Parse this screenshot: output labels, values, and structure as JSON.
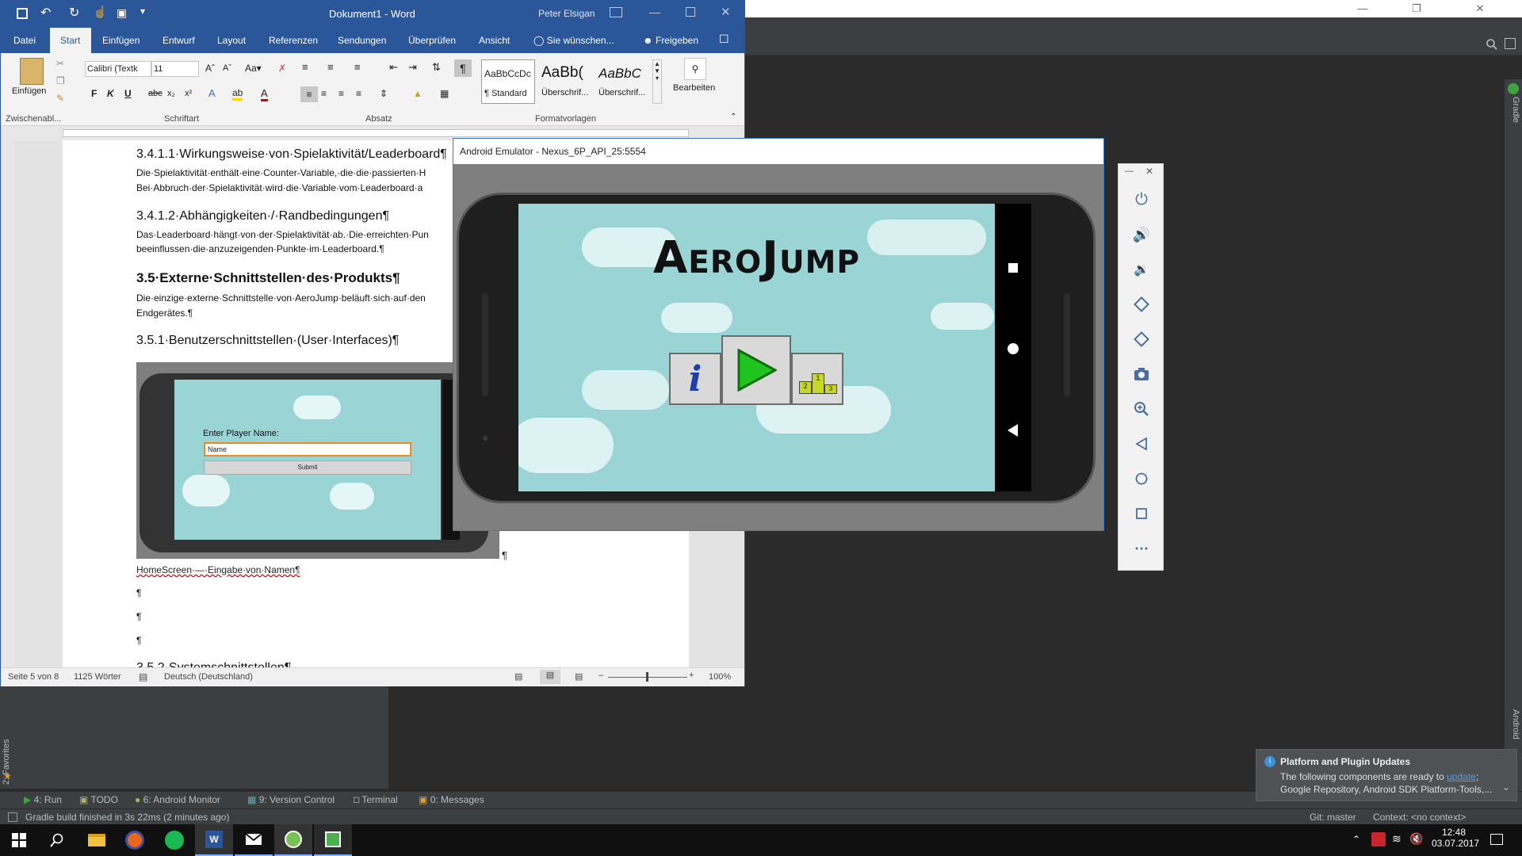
{
  "studio": {
    "tool_tabs": [
      "4: Run",
      "TODO",
      "6: Android Monitor",
      "9: Version Control",
      "Terminal",
      "0: Messages"
    ],
    "left_vertical_tab": "2: Favorites",
    "right_vertical_top": "Gradle",
    "right_vertical_bottom": "Android",
    "status_left": "Gradle build finished in 3s 22ms (2 minutes ago)",
    "status_git": "Git: master",
    "status_context": "Context: <no context>",
    "notification": {
      "title": "Platform and Plugin Updates",
      "line1_prefix": "The following components are ready to ",
      "line1_link": "update",
      "line1_suffix": ";",
      "line2": "Google Repository, Android SDK Platform-Tools,..."
    }
  },
  "word": {
    "title": "Dokument1 - Word",
    "user": "Peter Elsigan",
    "tabs": [
      "Datei",
      "Start",
      "Einfügen",
      "Entwurf",
      "Layout",
      "Referenzen",
      "Sendungen",
      "Überprüfen",
      "Ansicht"
    ],
    "active_tab": "Start",
    "tell_me": "Sie wünschen...",
    "share": "Freigeben",
    "ribbon": {
      "paste_label": "Einfügen",
      "font_name": "Calibri (Textk",
      "font_size": "11",
      "style_standard_preview": "AaBbCcDc",
      "style_standard_name": "¶ Standard",
      "style_h1_preview": "AaBb(",
      "style_h1_name": "Überschrif...",
      "style_h2_preview": "AaBbC",
      "style_h2_name": "Überschrif...",
      "edit_label": "Bearbeiten",
      "groups": [
        "Zwischenabl...",
        "Schriftart",
        "Absatz",
        "Formatvorlagen"
      ]
    },
    "document": {
      "h1": "3.4.1.1·Wirkungsweise·von·Spielaktivität/Leaderboard¶",
      "p1a": "Die·Spielaktivität·enthält·eine·Counter-Variable,·die·die·passierten·H",
      "p1b": "Bei·Abbruch·der·Spielaktivität·wird·die·Variable·vom·Leaderboard·a",
      "h2": "3.4.1.2·Abhängigkeiten·/·Randbedingungen¶",
      "p2a": "Das·Leaderboard·hängt·von·der·Spielaktivität·ab.·Die·erreichten·Pun",
      "p2b": "beeinflussen·die·anzuzeigenden·Punkte·im·Leaderboard.¶",
      "h3": "3.5·Externe·Schnittstellen·des·Produkts¶",
      "p3a": "Die·einzige·externe·Schnittstelle·von·AeroJump·beläuft·sich·auf·den",
      "p3b": "Endgerätes.¶",
      "h4": "3.5.1·Benutzerschnittstellen·(User·Interfaces)¶",
      "img_label": "Enter Player Name:",
      "img_input": "Name",
      "img_button": "Submit",
      "pilcrow_after_img": "¶",
      "caption": "HomeScreen·—·Eingabe·von·Namen¶",
      "empty_para": "¶",
      "h5": "3.5.2·Systemschnittstellen¶"
    },
    "status": {
      "page": "Seite 5 von 8",
      "words": "1125 Wörter",
      "language": "Deutsch (Deutschland)",
      "zoom": "100%"
    }
  },
  "emulator": {
    "title": "Android Emulator - Nexus_6P_API_25:5554",
    "game_title": "AeroJump",
    "info_glyph": "i",
    "podium_numbers": [
      "2",
      "1",
      "3"
    ]
  },
  "taskbar": {
    "time": "12:48",
    "date": "03.07.2017"
  },
  "colors": {
    "word_blue": "#2b579a",
    "sky": "#9bd4d4",
    "play_green": "#1fc41f"
  }
}
